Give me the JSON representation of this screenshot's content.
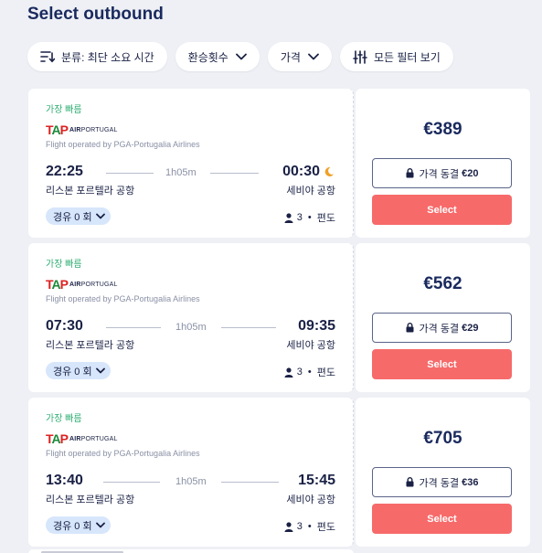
{
  "page": {
    "title": "Select outbound"
  },
  "filters": {
    "sort": {
      "label": "분류: 최단 소요 시간",
      "icon": "sort-icon"
    },
    "transfers": {
      "label": "환승횟수",
      "icon": "chevron-down-icon"
    },
    "price": {
      "label": "가격",
      "icon": "chevron-down-icon"
    },
    "all_filters": {
      "label": "모든 필터 보기",
      "icon": "sliders-icon"
    }
  },
  "flights": [
    {
      "tag": "가장 빠름",
      "airline_logo_text": "TAP AIR PORTUGAL",
      "operated_by": "Flight operated by PGA-Portugalia Airlines",
      "departure_time": "22:25",
      "arrival_time": "00:30",
      "arrival_next_day_icon": "moon-icon",
      "duration": "1h05m",
      "departure_airport": "리스본 포르텔라 공항",
      "arrival_airport": "세비야 공항",
      "stops_label": "경유 0 회",
      "passengers": "3",
      "trip_type": "편도",
      "price": "€389",
      "price_lock_label": "가격 동결",
      "price_lock_amount": "€20",
      "select_label": "Select"
    },
    {
      "tag": "가장 빠름",
      "airline_logo_text": "TAP AIR PORTUGAL",
      "operated_by": "Flight operated by PGA-Portugalia Airlines",
      "departure_time": "07:30",
      "arrival_time": "09:35",
      "duration": "1h05m",
      "departure_airport": "리스본 포르텔라 공항",
      "arrival_airport": "세비야 공항",
      "stops_label": "경유 0 회",
      "passengers": "3",
      "trip_type": "편도",
      "price": "€562",
      "price_lock_label": "가격 동결",
      "price_lock_amount": "€29",
      "select_label": "Select"
    },
    {
      "tag": "가장 빠름",
      "airline_logo_text": "TAP AIR PORTUGAL",
      "operated_by": "Flight operated by PGA-Portugalia Airlines",
      "departure_time": "13:40",
      "arrival_time": "15:45",
      "duration": "1h05m",
      "departure_airport": "리스본 포르텔라 공항",
      "arrival_airport": "세비야 공항",
      "stops_label": "경유 0 회",
      "passengers": "3",
      "trip_type": "편도",
      "price": "€705",
      "price_lock_label": "가격 동결",
      "price_lock_amount": "€36",
      "select_label": "Select"
    }
  ],
  "colors": {
    "accent_select": "#f76a6a",
    "tag_green": "#2fae72",
    "navy": "#1a2a5e",
    "stops_badge": "#d7e6fb",
    "moon": "#f0a028"
  }
}
